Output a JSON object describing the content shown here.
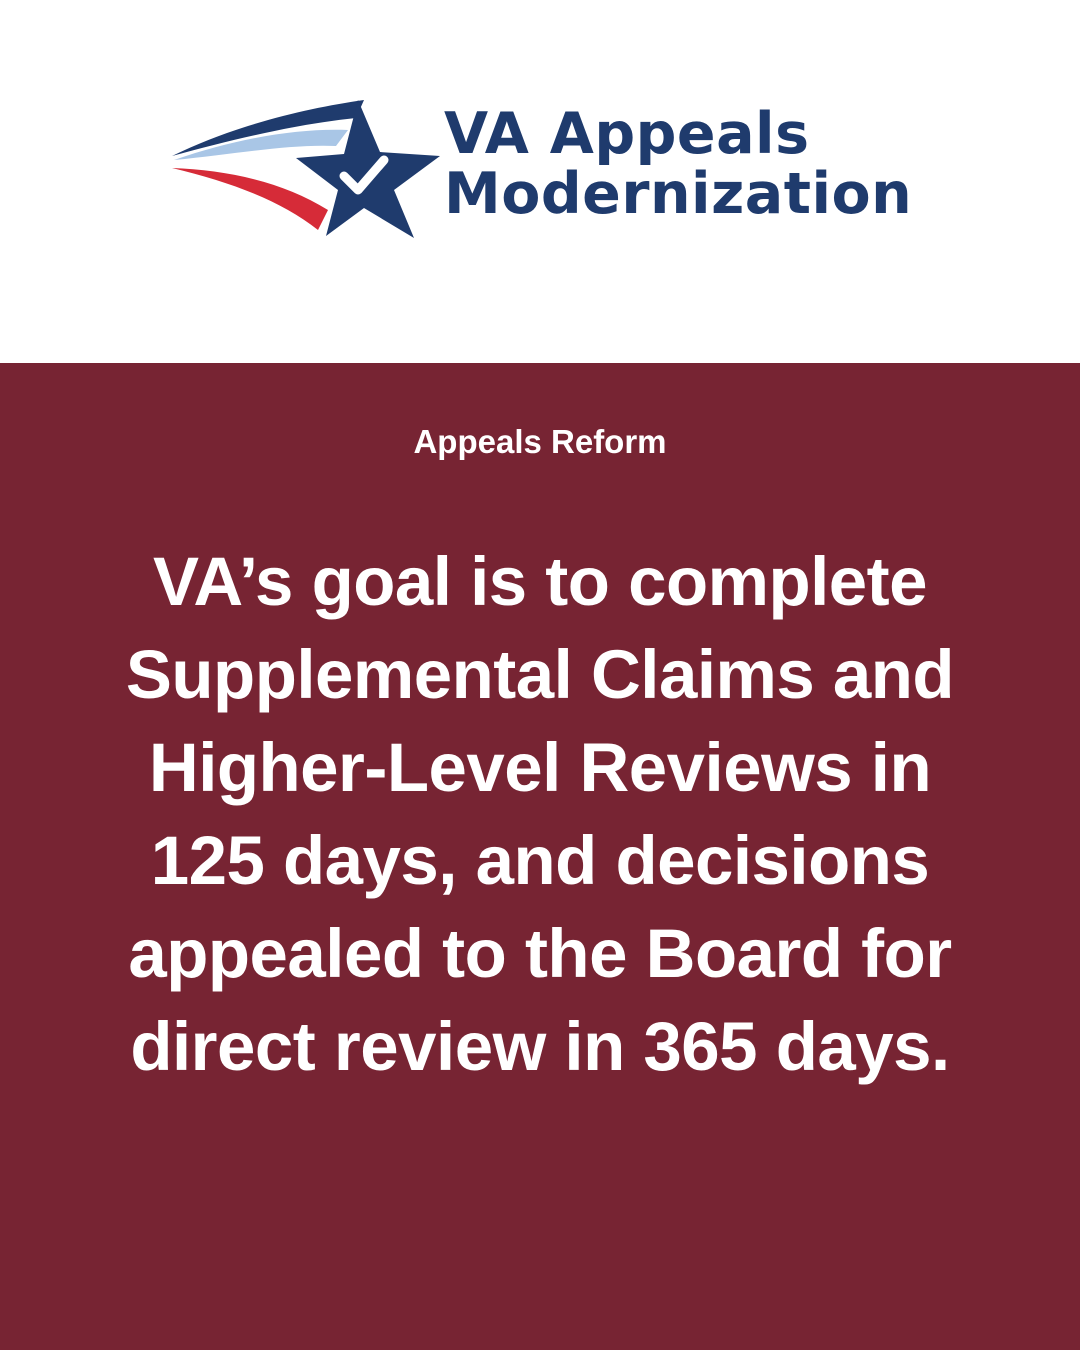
{
  "logo": {
    "line1": "VA Appeals",
    "line2": "Modernization",
    "icon": "star-check-swoosh-icon"
  },
  "panel": {
    "eyebrow": "Appeals Reform",
    "headline": "VA’s goal is to complete Supplemental Claims and Higher-Level Reviews in 125 days, and decisions appealed to the Board for direct review in 365 days."
  },
  "colors": {
    "background": "#ffffff",
    "panel": "#772433",
    "brand_navy": "#1f3b6d",
    "brand_light_blue": "#a9c6e6",
    "brand_red": "#d62b38",
    "text_on_panel": "#ffffff"
  }
}
